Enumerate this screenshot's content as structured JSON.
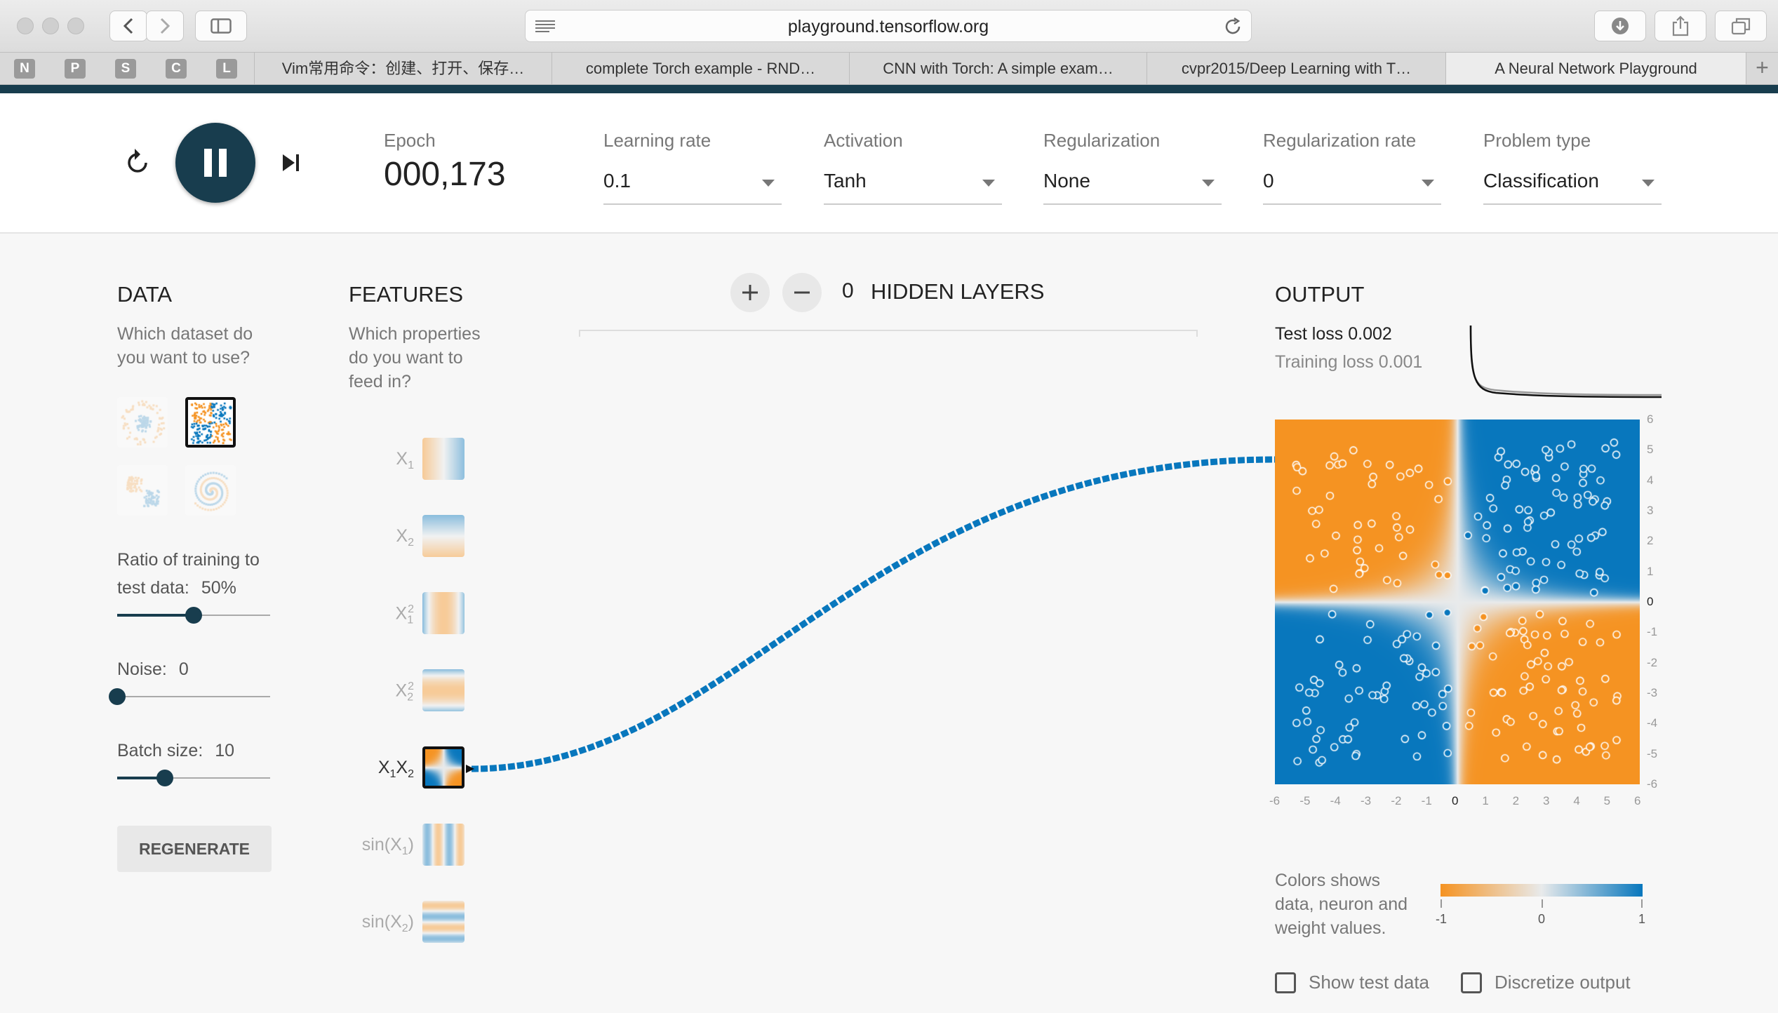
{
  "browser": {
    "url": "playground.tensorflow.org",
    "pinned_tabs": [
      "N",
      "P",
      "S",
      "C",
      "L"
    ],
    "tabs": [
      {
        "title": "Vim常用命令：创建、打开、保存…",
        "active": false
      },
      {
        "title": "complete Torch example - RND…",
        "active": false
      },
      {
        "title": "CNN with Torch: A simple exam…",
        "active": false
      },
      {
        "title": "cvpr2015/Deep Learning with T…",
        "active": false
      },
      {
        "title": "A Neural Network Playground",
        "active": true
      }
    ],
    "new_tab_label": "+"
  },
  "controls": {
    "epoch_label": "Epoch",
    "epoch_value": "000,173",
    "learning_rate": {
      "label": "Learning rate",
      "value": "0.1"
    },
    "activation": {
      "label": "Activation",
      "value": "Tanh"
    },
    "regularization": {
      "label": "Regularization",
      "value": "None"
    },
    "regularization_rate": {
      "label": "Regularization rate",
      "value": "0"
    },
    "problem_type": {
      "label": "Problem type",
      "value": "Classification"
    }
  },
  "data": {
    "title": "DATA",
    "subtitle_line1": "Which dataset do",
    "subtitle_line2": "you want to use?",
    "datasets": [
      {
        "name": "circle",
        "selected": false
      },
      {
        "name": "xor",
        "selected": true
      },
      {
        "name": "gaussian",
        "selected": false
      },
      {
        "name": "spiral",
        "selected": false
      }
    ],
    "ratio_label_line1": "Ratio of training to",
    "ratio_label_line2": "test data:",
    "ratio_value": "50%",
    "ratio_level": 0.5,
    "noise_label": "Noise:",
    "noise_value": "0",
    "noise_level": 0,
    "batch_label": "Batch size:",
    "batch_value": "10",
    "batch_level": 0.31,
    "regenerate_label": "REGENERATE"
  },
  "features": {
    "title": "FEATURES",
    "subtitle_line1": "Which properties",
    "subtitle_line2": "do you want to",
    "subtitle_line3": "feed in?",
    "items": [
      {
        "base": "X",
        "sub": "1",
        "sup": "",
        "base2": "",
        "sub2": "",
        "prefix": "",
        "suffix": "",
        "active": false
      },
      {
        "base": "X",
        "sub": "2",
        "sup": "",
        "base2": "",
        "sub2": "",
        "prefix": "",
        "suffix": "",
        "active": false
      },
      {
        "base": "X",
        "sub": "1",
        "sup": "2",
        "base2": "",
        "sub2": "",
        "prefix": "",
        "suffix": "",
        "active": false
      },
      {
        "base": "X",
        "sub": "2",
        "sup": "2",
        "base2": "",
        "sub2": "",
        "prefix": "",
        "suffix": "",
        "active": false
      },
      {
        "base": "X",
        "sub": "1",
        "sup": "",
        "base2": "X",
        "sub2": "2",
        "prefix": "",
        "suffix": "",
        "active": true
      },
      {
        "base": "X",
        "sub": "1",
        "sup": "",
        "base2": "",
        "sub2": "",
        "prefix": "sin(",
        "suffix": ")",
        "active": false
      },
      {
        "base": "X",
        "sub": "2",
        "sup": "",
        "base2": "",
        "sub2": "",
        "prefix": "sin(",
        "suffix": ")",
        "active": false
      }
    ]
  },
  "network": {
    "hidden_layers_count": "0",
    "hidden_layers_label": "HIDDEN LAYERS",
    "add_layer_icon": "plus-icon",
    "remove_layer_icon": "minus-icon",
    "link_color": "#0877bd"
  },
  "output": {
    "title": "OUTPUT",
    "test_loss_label": "Test loss",
    "test_loss_value": "0.002",
    "training_loss_label": "Training loss",
    "training_loss_value": "0.001",
    "x_ticks": [
      "-6",
      "-5",
      "-4",
      "-3",
      "-2",
      "-1",
      "0",
      "1",
      "2",
      "3",
      "4",
      "5",
      "6"
    ],
    "y_ticks": [
      "6",
      "5",
      "4",
      "3",
      "2",
      "1",
      "0",
      "-1",
      "-2",
      "-3",
      "-4",
      "-5",
      "-6"
    ],
    "legend_line1": "Colors shows",
    "legend_line2": "data, neuron and",
    "legend_line3": "weight values.",
    "legend_ticks": [
      "-1",
      "0",
      "1"
    ],
    "show_test_data_label": "Show test data",
    "discretize_label": "Discretize output",
    "colors": {
      "negative": "#f59322",
      "positive": "#0877bd",
      "neutral": "#e8eaeb"
    }
  }
}
